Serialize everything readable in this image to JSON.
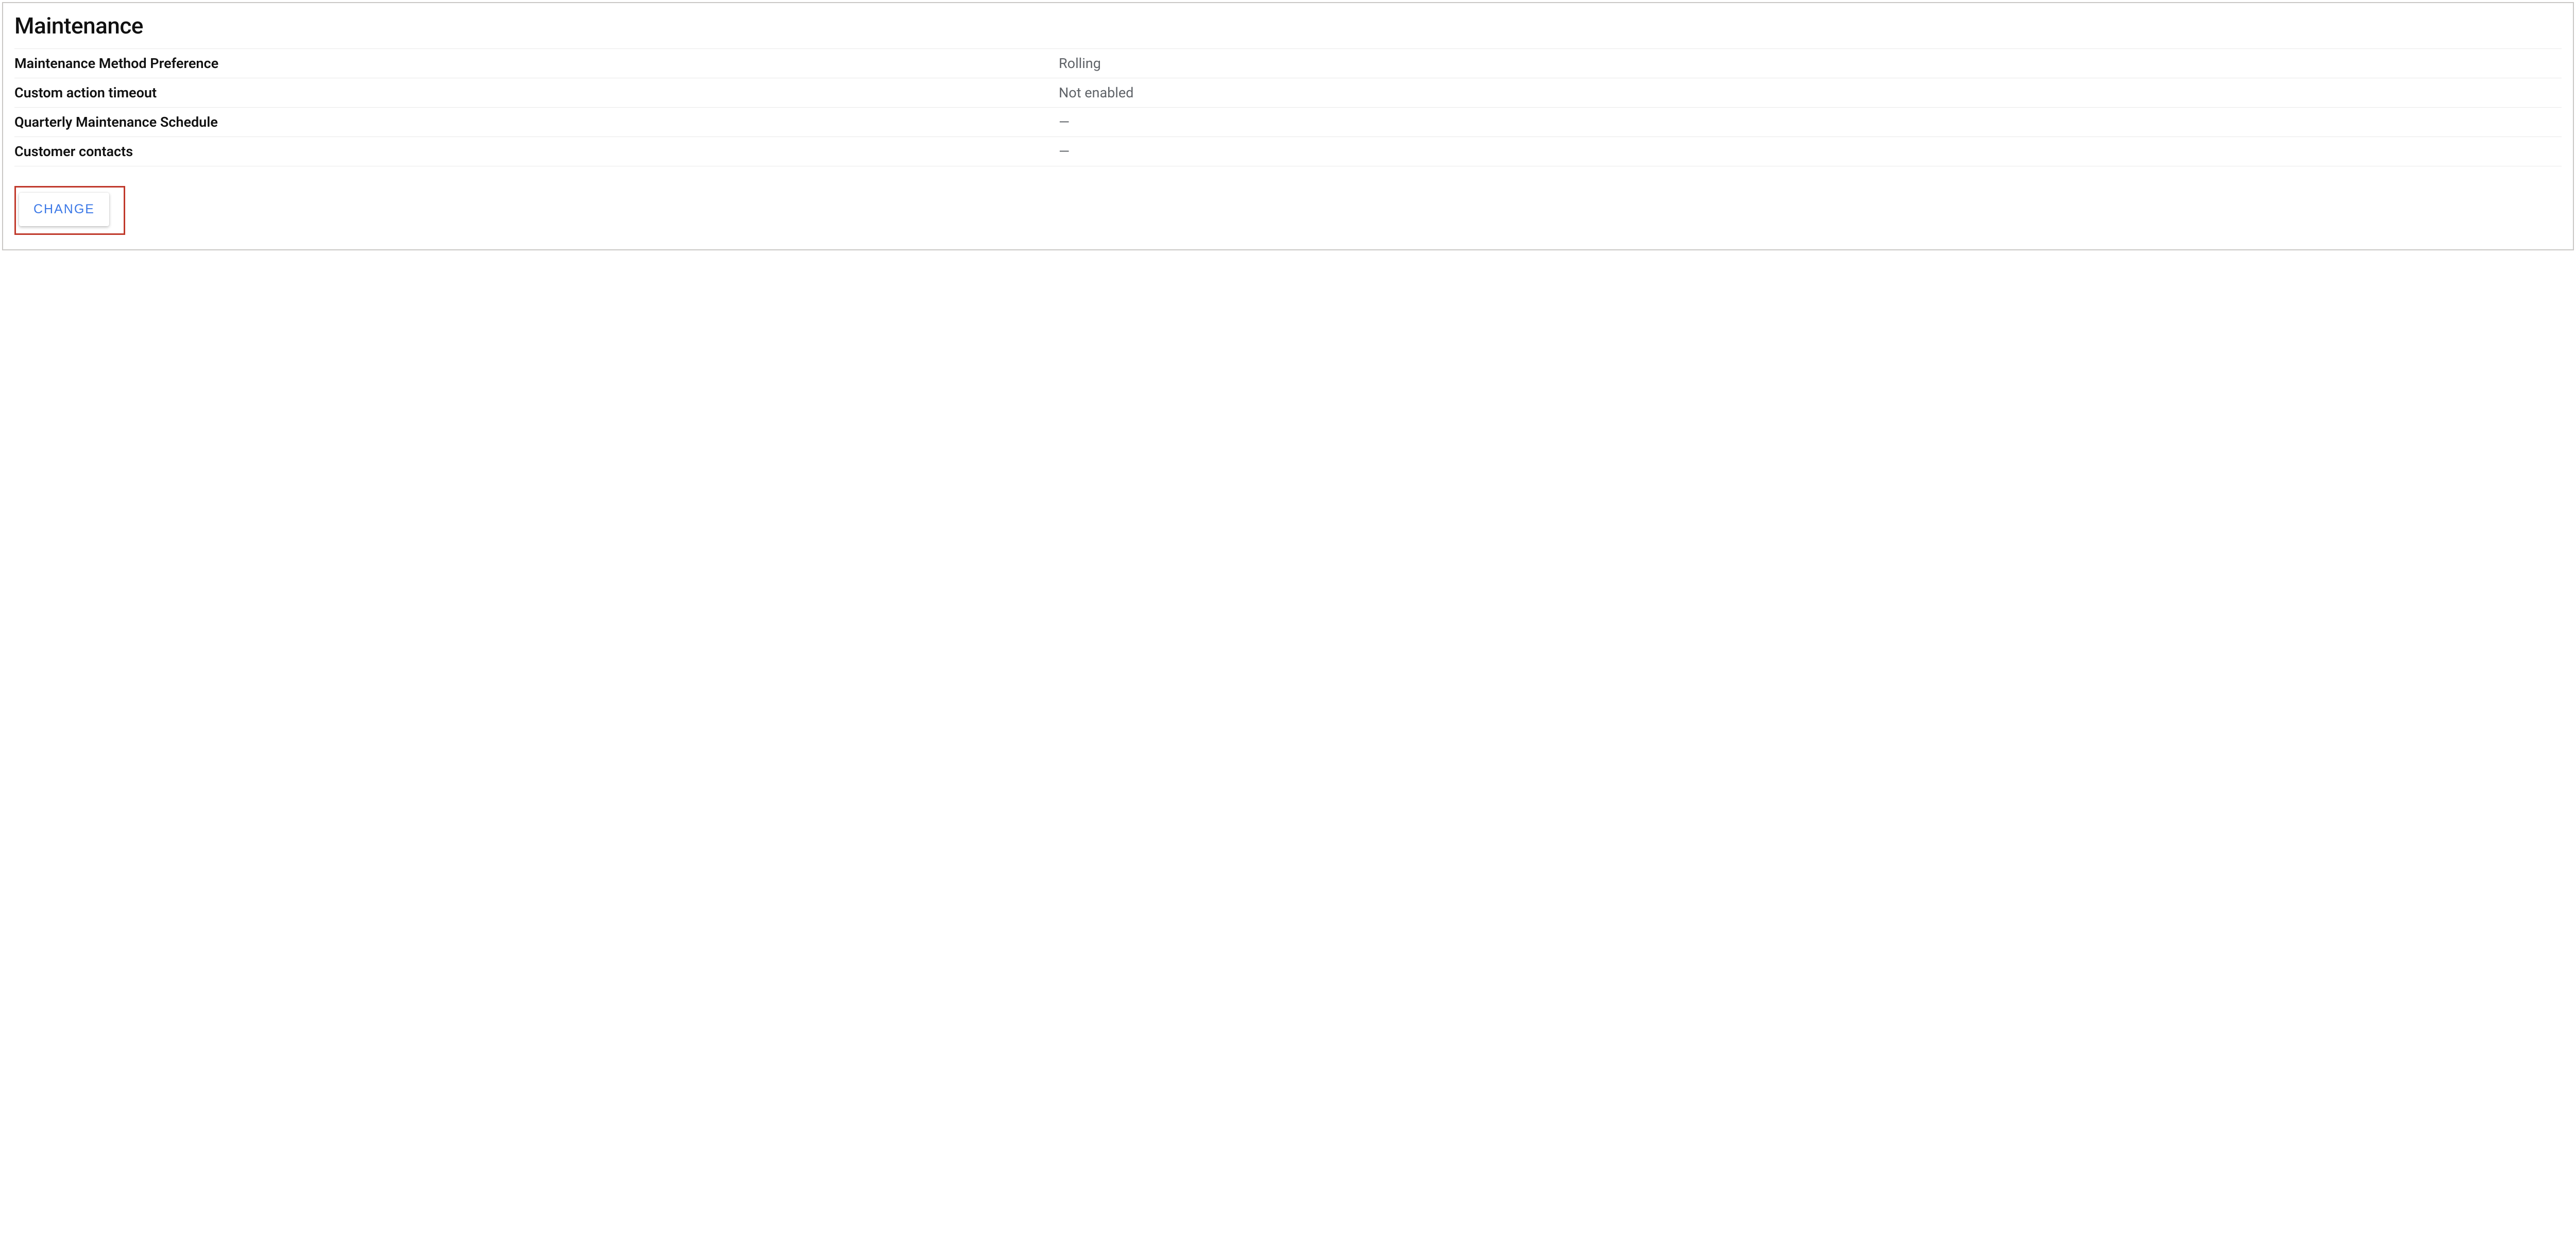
{
  "section": {
    "title": "Maintenance"
  },
  "rows": [
    {
      "label": "Maintenance Method Preference",
      "value": "Rolling"
    },
    {
      "label": "Custom action timeout",
      "value": "Not enabled"
    },
    {
      "label": "Quarterly Maintenance Schedule",
      "value": "—"
    },
    {
      "label": "Customer contacts",
      "value": "—"
    }
  ],
  "actions": {
    "change_label": "CHANGE"
  }
}
